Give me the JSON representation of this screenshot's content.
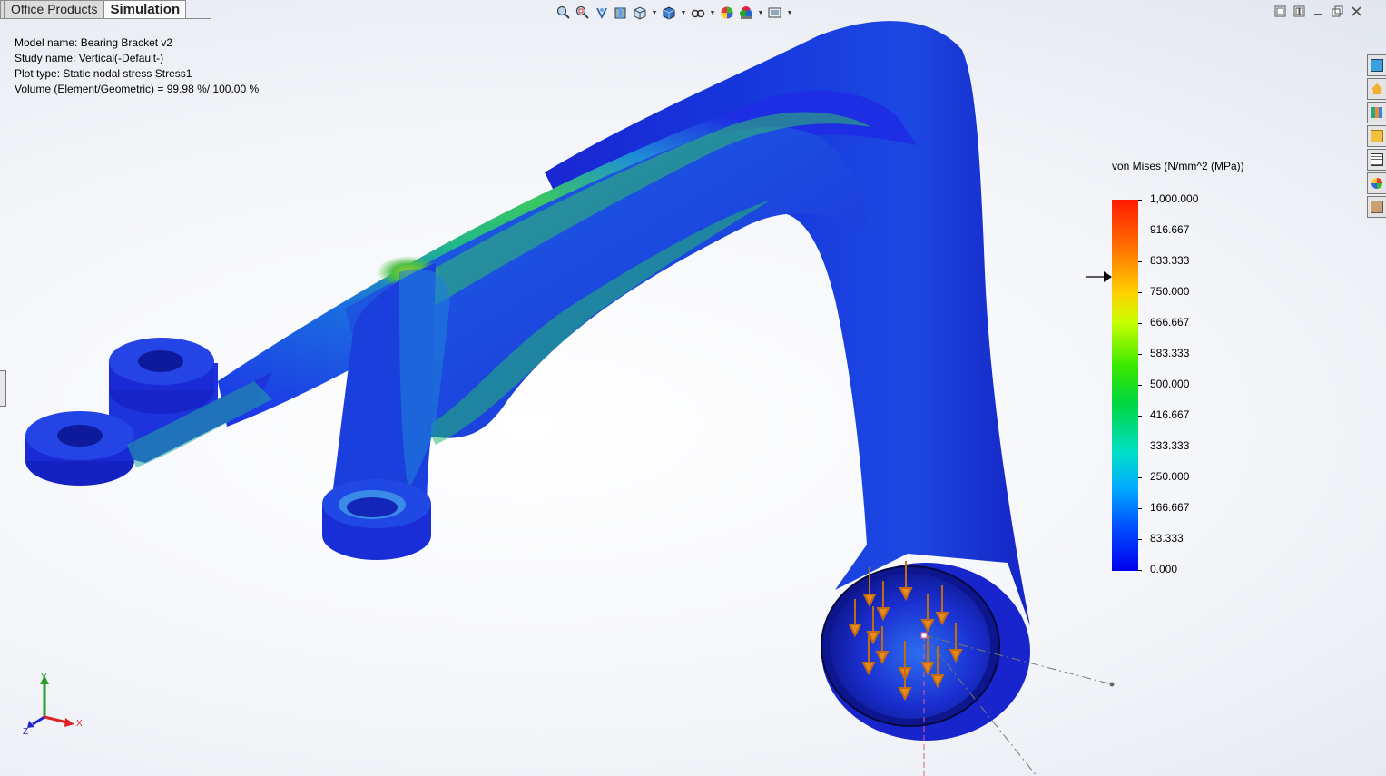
{
  "tabs": [
    {
      "label": "s"
    },
    {
      "label": "Office Products"
    },
    {
      "label": "Simulation"
    }
  ],
  "toolbar": {
    "icons": [
      "zoom-to-fit-icon",
      "zoom-to-area-icon",
      "previous-view-icon",
      "section-view-icon",
      "view-orientation-icon",
      "display-style-icon",
      "hide-show-items-icon",
      "edit-appearance-icon",
      "apply-scene-icon",
      "view-settings-icon"
    ]
  },
  "info": {
    "model_name": "Model name: Bearing Bracket v2",
    "study_name": "Study name: Vertical(-Default-)",
    "plot_type": "Plot type: Static nodal stress Stress1",
    "volume": "Volume (Element/Geometric) = 99.98 %/ 100.00 %"
  },
  "legend": {
    "title": "von Mises (N/mm^2 (MPa))",
    "ticks": [
      "1,000.000",
      "916.667",
      "833.333",
      "750.000",
      "666.667",
      "583.333",
      "500.000",
      "416.667",
      "333.333",
      "250.000",
      "166.667",
      "83.333",
      "0.000"
    ],
    "yield_marker_value": 810
  },
  "triad": {
    "x": "X",
    "y": "Y",
    "z": "Z"
  },
  "colors": {
    "low_stress": "#1a2ee0",
    "high_stress": "#ff1a00",
    "load_arrow": "#e8891c"
  }
}
